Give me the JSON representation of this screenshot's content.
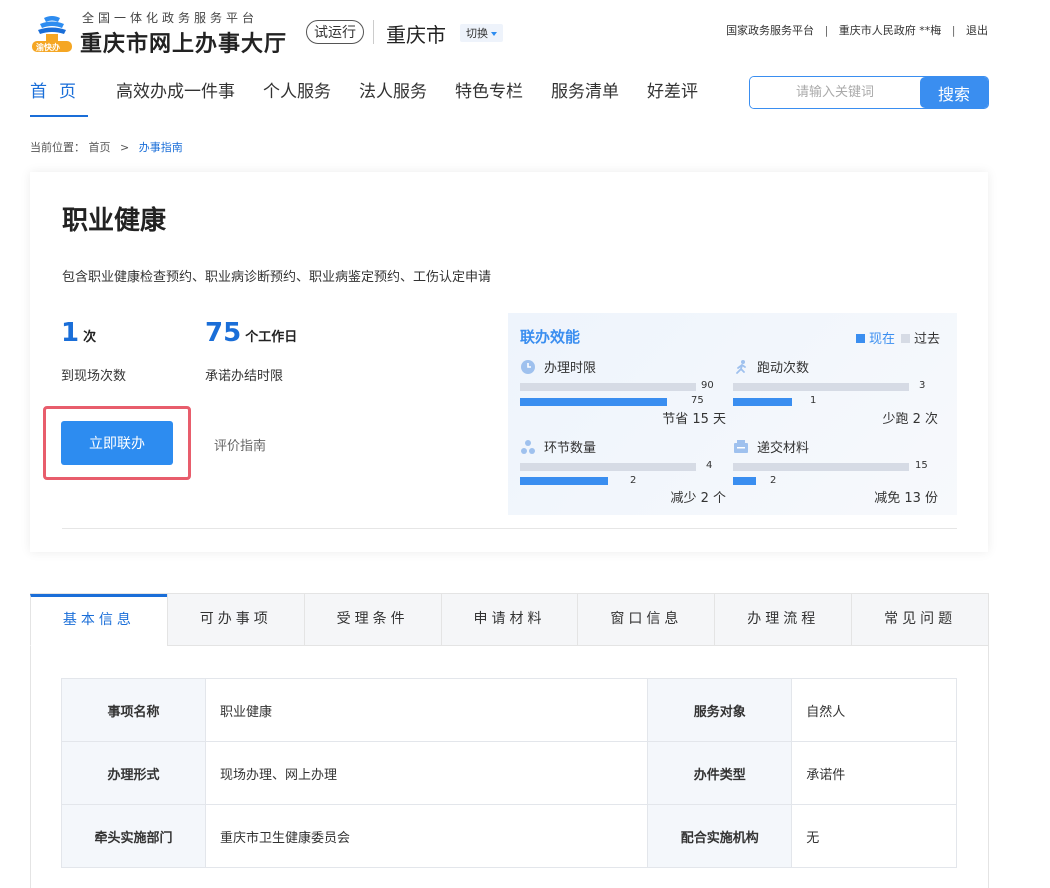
{
  "header": {
    "platform_sub": "全国一体化政务服务平台",
    "site_title": "重庆市网上办事大厅",
    "logo_badge": "渝快办",
    "trial_badge": "试运行",
    "city": "重庆市",
    "switch_label": "切换",
    "top_links": [
      "国家政务服务平台",
      "重庆市人民政府 **梅",
      "退出"
    ]
  },
  "nav": {
    "items": [
      "首页",
      "高效办成一件事",
      "个人服务",
      "法人服务",
      "特色专栏",
      "服务清单",
      "好差评"
    ],
    "active_index": 0
  },
  "search": {
    "placeholder": "请输入关键词",
    "button_label": "搜索"
  },
  "breadcrumb": {
    "prefix": "当前位置：",
    "items": [
      "首页",
      "办事指南"
    ]
  },
  "service": {
    "title": "职业健康",
    "description": "包含职业健康检查预约、职业病诊断预约、职业病鉴定预约、工伤认定申请",
    "stats": [
      {
        "value": "1",
        "unit": "次",
        "label": "到现场次数"
      },
      {
        "value": "75",
        "unit": "个工作日",
        "label": "承诺办结时限"
      }
    ],
    "apply_button": "立即联办",
    "guide_link": "评价指南"
  },
  "efficiency": {
    "title": "联办效能",
    "legend_now": "现在",
    "legend_past": "过去",
    "color_now": "#3a8ef0",
    "color_past": "#d6dbe5",
    "metrics": [
      {
        "icon": "clock-icon",
        "label": "办理时限",
        "past": 90,
        "now": 75,
        "summary": "节省 15 天"
      },
      {
        "icon": "runner-icon",
        "label": "跑动次数",
        "past": 3,
        "now": 1,
        "summary": "少跑 2 次"
      },
      {
        "icon": "nodes-icon",
        "label": "环节数量",
        "past": 4,
        "now": 2,
        "summary": "减少 2 个"
      },
      {
        "icon": "folder-icon",
        "label": "递交材料",
        "past": 15,
        "now": 2,
        "summary": "减免 13 份"
      }
    ]
  },
  "tabs": {
    "items": [
      "基本信息",
      "可办事项",
      "受理条件",
      "申请材料",
      "窗口信息",
      "办理流程",
      "常见问题"
    ],
    "active_index": 0
  },
  "basic_info": {
    "rows": [
      [
        {
          "label": "事项名称",
          "value": "职业健康"
        },
        {
          "label": "服务对象",
          "value": "自然人"
        }
      ],
      [
        {
          "label": "办理形式",
          "value": "现场办理、网上办理"
        },
        {
          "label": "办件类型",
          "value": "承诺件"
        }
      ],
      [
        {
          "label": "牵头实施部门",
          "value": "重庆市卫生健康委员会"
        },
        {
          "label": "配合实施机构",
          "value": "无"
        }
      ]
    ]
  }
}
